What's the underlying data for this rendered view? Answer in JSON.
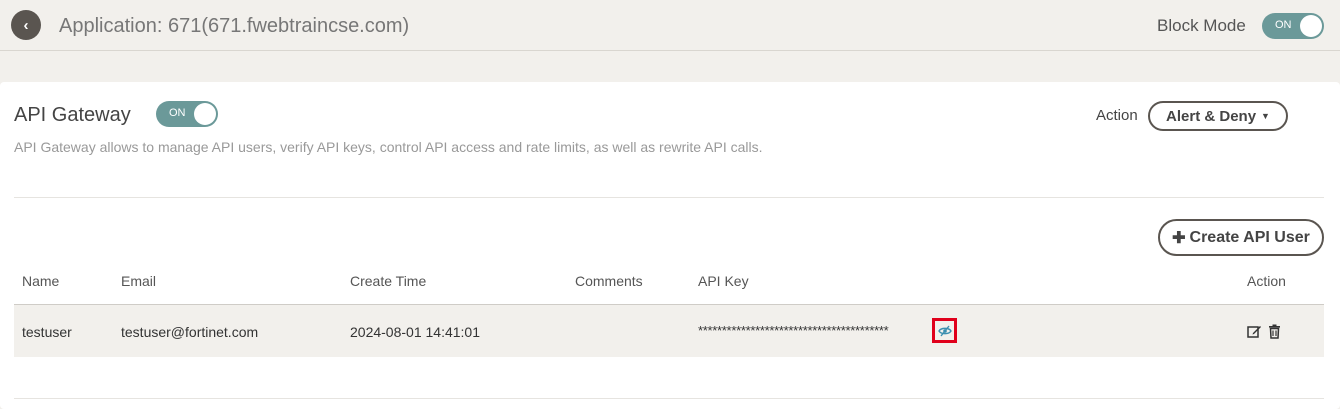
{
  "header": {
    "back_icon": "chevron-left-icon",
    "title": "Application: 671(671.fwebtraincse.com)",
    "block_mode_label": "Block Mode",
    "block_mode_toggle": "ON"
  },
  "gateway": {
    "title": "API Gateway",
    "toggle": "ON",
    "description": "API Gateway allows to manage API users, verify API keys, control API access and rate limits, as well as rewrite API calls.",
    "action_label": "Action",
    "action_value": "Alert & Deny",
    "create_button": "Create API User"
  },
  "table": {
    "columns": [
      "Name",
      "Email",
      "Create Time",
      "Comments",
      "API Key",
      "Action"
    ],
    "rows": [
      {
        "name": "testuser",
        "email": "testuser@fortinet.com",
        "create_time": "2024-08-01 14:41:01",
        "comments": "",
        "api_key": "****************************************"
      }
    ]
  },
  "colors": {
    "toggle_on": "#6b9999",
    "highlight": "#e0001b",
    "row_bg": "#f2f0ec"
  }
}
